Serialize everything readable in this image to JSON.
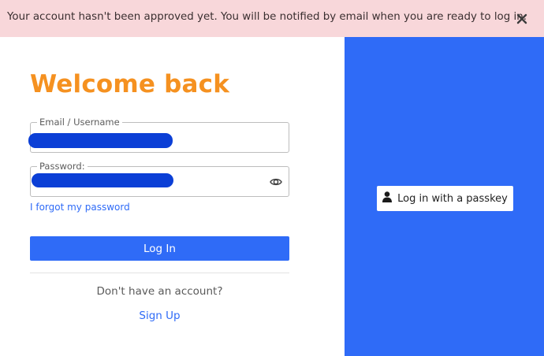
{
  "banner": {
    "message": "Your account hasn't been approved yet. You will be notified by email when you are ready to log in.",
    "close_icon": "close-icon",
    "background": "#f8d7da"
  },
  "login": {
    "title": "Welcome back",
    "title_color": "#f59120",
    "email_label": "Email / Username",
    "email_value": "",
    "password_label": "Password:",
    "password_value": "",
    "show_password_icon": "eye-icon",
    "forgot_link": "I forgot my password",
    "login_button": "Log In",
    "no_account_text": "Don't have an account?",
    "signup_link": "Sign Up"
  },
  "passkey": {
    "button_label": "Log in with a passkey",
    "icon": "user-icon",
    "panel_color": "#2f6bf7"
  },
  "redaction_color": "#0b3fd6"
}
